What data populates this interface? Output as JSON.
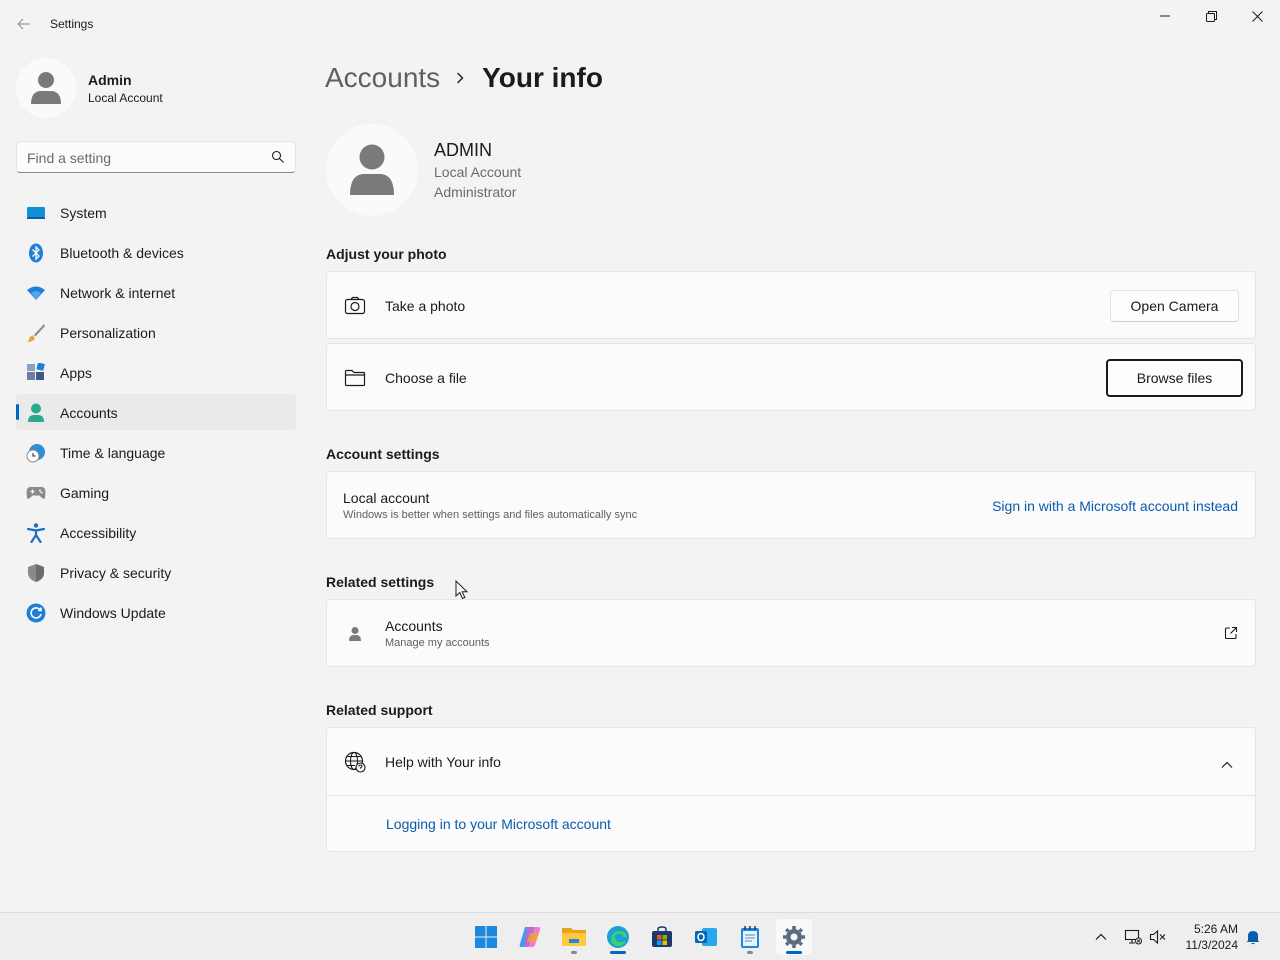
{
  "window": {
    "app_title": "Settings"
  },
  "profile": {
    "name": "Admin",
    "account_type": "Local Account"
  },
  "search": {
    "placeholder": "Find a setting",
    "value": ""
  },
  "sidebar": {
    "items": [
      {
        "label": "System",
        "icon": "system-icon",
        "active": false
      },
      {
        "label": "Bluetooth & devices",
        "icon": "bluetooth-icon",
        "active": false
      },
      {
        "label": "Network & internet",
        "icon": "wifi-icon",
        "active": false
      },
      {
        "label": "Personalization",
        "icon": "brush-icon",
        "active": false
      },
      {
        "label": "Apps",
        "icon": "apps-icon",
        "active": false
      },
      {
        "label": "Accounts",
        "icon": "accounts-icon",
        "active": true
      },
      {
        "label": "Time & language",
        "icon": "clock-globe-icon",
        "active": false
      },
      {
        "label": "Gaming",
        "icon": "gamepad-icon",
        "active": false
      },
      {
        "label": "Accessibility",
        "icon": "accessibility-icon",
        "active": false
      },
      {
        "label": "Privacy & security",
        "icon": "shield-icon",
        "active": false
      },
      {
        "label": "Windows Update",
        "icon": "update-icon",
        "active": false
      }
    ]
  },
  "breadcrumb": {
    "parent": "Accounts",
    "current": "Your info"
  },
  "user": {
    "name": "ADMIN",
    "account_type": "Local Account",
    "role": "Administrator"
  },
  "adjust_photo": {
    "title": "Adjust your photo",
    "take_photo_label": "Take a photo",
    "open_camera_button": "Open Camera",
    "choose_file_label": "Choose a file",
    "browse_files_button": "Browse files"
  },
  "account_settings": {
    "title": "Account settings",
    "local_account_label": "Local account",
    "local_account_desc": "Windows is better when settings and files automatically sync",
    "sign_in_link": "Sign in with a Microsoft account instead"
  },
  "related_settings": {
    "title": "Related settings",
    "accounts_label": "Accounts",
    "accounts_desc": "Manage my accounts"
  },
  "related_support": {
    "title": "Related support",
    "help_label": "Help with Your info",
    "help_link": "Logging in to your Microsoft account"
  },
  "taskbar": {
    "apps": [
      "start-icon",
      "copilot-icon",
      "file-explorer-icon",
      "edge-icon",
      "store-icon",
      "outlook-icon",
      "notepad-icon",
      "settings-icon"
    ],
    "clock_time": "5:26 AM",
    "clock_date": "11/3/2024"
  },
  "colors": {
    "accent": "#0067c0",
    "link": "#0a5cae",
    "background": "#f3f3f3",
    "card": "#fbfbfb"
  }
}
